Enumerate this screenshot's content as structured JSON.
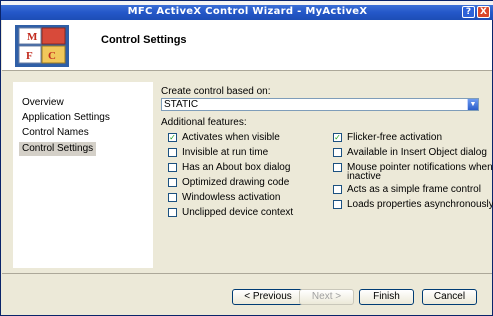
{
  "window": {
    "title": "MFC ActiveX Control Wizard - MyActiveX",
    "help_glyph": "?",
    "close_glyph": "X"
  },
  "header": {
    "title": "Control Settings",
    "logo_letters": [
      "M",
      "F",
      "C"
    ]
  },
  "nav": {
    "items": [
      {
        "label": "Overview",
        "selected": false
      },
      {
        "label": "Application Settings",
        "selected": false
      },
      {
        "label": "Control Names",
        "selected": false
      },
      {
        "label": "Control Settings",
        "selected": true
      }
    ]
  },
  "main": {
    "base_label": "Create control based on:",
    "base_value": "STATIC",
    "features_label": "Additional features:",
    "left_options": [
      {
        "label": "Activates when visible",
        "checked": true
      },
      {
        "label": "Invisible at run time",
        "checked": false
      },
      {
        "label": "Has an About box dialog",
        "checked": false
      },
      {
        "label": "Optimized drawing code",
        "checked": false
      },
      {
        "label": "Windowless activation",
        "checked": false
      },
      {
        "label": "Unclipped device context",
        "checked": false
      }
    ],
    "right_options": [
      {
        "label": "Flicker-free activation",
        "checked": true
      },
      {
        "label": "Available in Insert Object dialog",
        "checked": false
      },
      {
        "label": "Mouse pointer notifications when",
        "label2": "inactive",
        "checked": false
      },
      {
        "label": "Acts as a simple frame control",
        "checked": false
      },
      {
        "label": "Loads properties asynchronously",
        "checked": false
      }
    ]
  },
  "buttons": {
    "previous": "< Previous",
    "next": "Next >",
    "finish": "Finish",
    "cancel": "Cancel"
  },
  "check_glyph": "✓"
}
